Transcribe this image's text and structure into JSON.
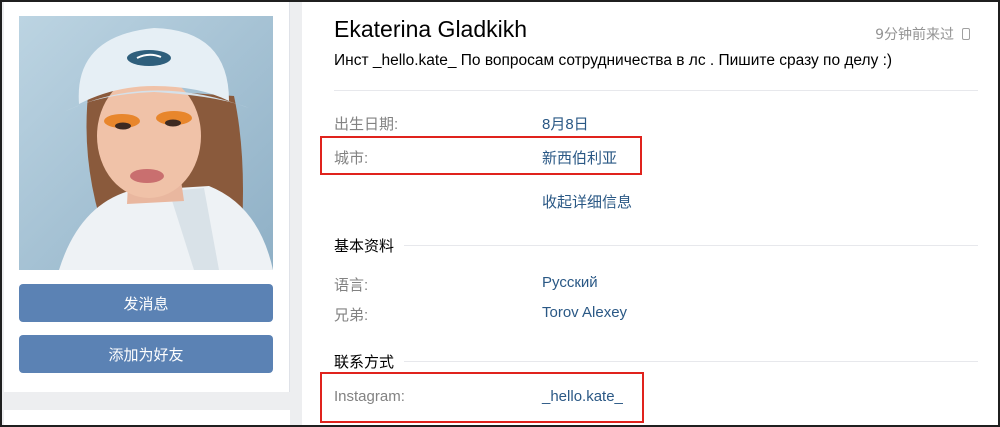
{
  "profile": {
    "name": "Ekaterina Gladkikh",
    "last_seen": "9分钟前来过",
    "status": "Инст _hello.kate_ По вопросам сотрудничества в лс . Пишите сразу по делу :)"
  },
  "actions": {
    "message_label": "发消息",
    "add_friend_label": "添加为好友"
  },
  "details": {
    "birthday_label": "出生日期:",
    "birthday_value": "8月8日",
    "city_label": "城市:",
    "city_value": "新西伯利亚",
    "collapse_label": "收起详细信息"
  },
  "basic_info": {
    "title": "基本资料",
    "language_label": "语言:",
    "language_value": "Русский",
    "brother_label": "兄弟:",
    "brother_value": "Torov Alexey"
  },
  "contacts": {
    "title": "联系方式",
    "instagram_label": "Instagram:",
    "instagram_value": "_hello.kate_"
  },
  "colors": {
    "link": "#2a5885",
    "button": "#5b82b4",
    "highlight": "#e0231d"
  }
}
